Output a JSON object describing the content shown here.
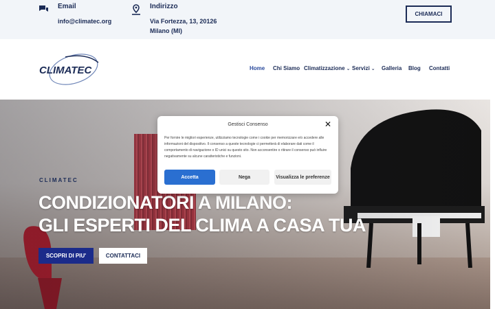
{
  "topbar": {
    "email_label": "Email",
    "email_value": "info@climatec.org",
    "address_label": "Indirizzo",
    "address_line1": "Via Fortezza, 13, 20126",
    "address_line2": "Milano (MI)",
    "call_button": "CHIAMACI"
  },
  "header": {
    "logo_text": "CLIMATEC",
    "nav": [
      {
        "label": "Home"
      },
      {
        "label": "Chi Siamo"
      },
      {
        "label": "Climatizzazione"
      },
      {
        "label": "Servizi"
      },
      {
        "label": "Galleria"
      },
      {
        "label": "Blog"
      },
      {
        "label": "Contatti"
      }
    ]
  },
  "hero": {
    "kicker": "CLIMATEC",
    "title_line1": "CONDIZIONATORI A MILANO:",
    "title_line2": "GLI ESPERTI DEL CLIMA A CASA TUA",
    "btn_more": "SCOPRI DI PIU'",
    "btn_contact": "CONTATTACI"
  },
  "consent": {
    "title": "Gestisci Consenso",
    "text": "Per fornire le migliori esperienze, utilizziamo tecnologie come i cookie per memorizzare e/o accedere alle informazioni del dispositivo. Il consenso a queste tecnologie ci permetterà di elaborare dati come il comportamento di navigazione o ID unici su questo sito. Non acconsentire o ritirare il consenso può influire negativamente su alcune caratteristiche e funzioni.",
    "accept": "Accetta",
    "deny": "Nega",
    "preferences": "Visualizza le preferenze"
  },
  "colors": {
    "navy": "#1b2b56",
    "accent_blue": "#2a6fd1",
    "topbar_bg": "#f2f5f9"
  }
}
